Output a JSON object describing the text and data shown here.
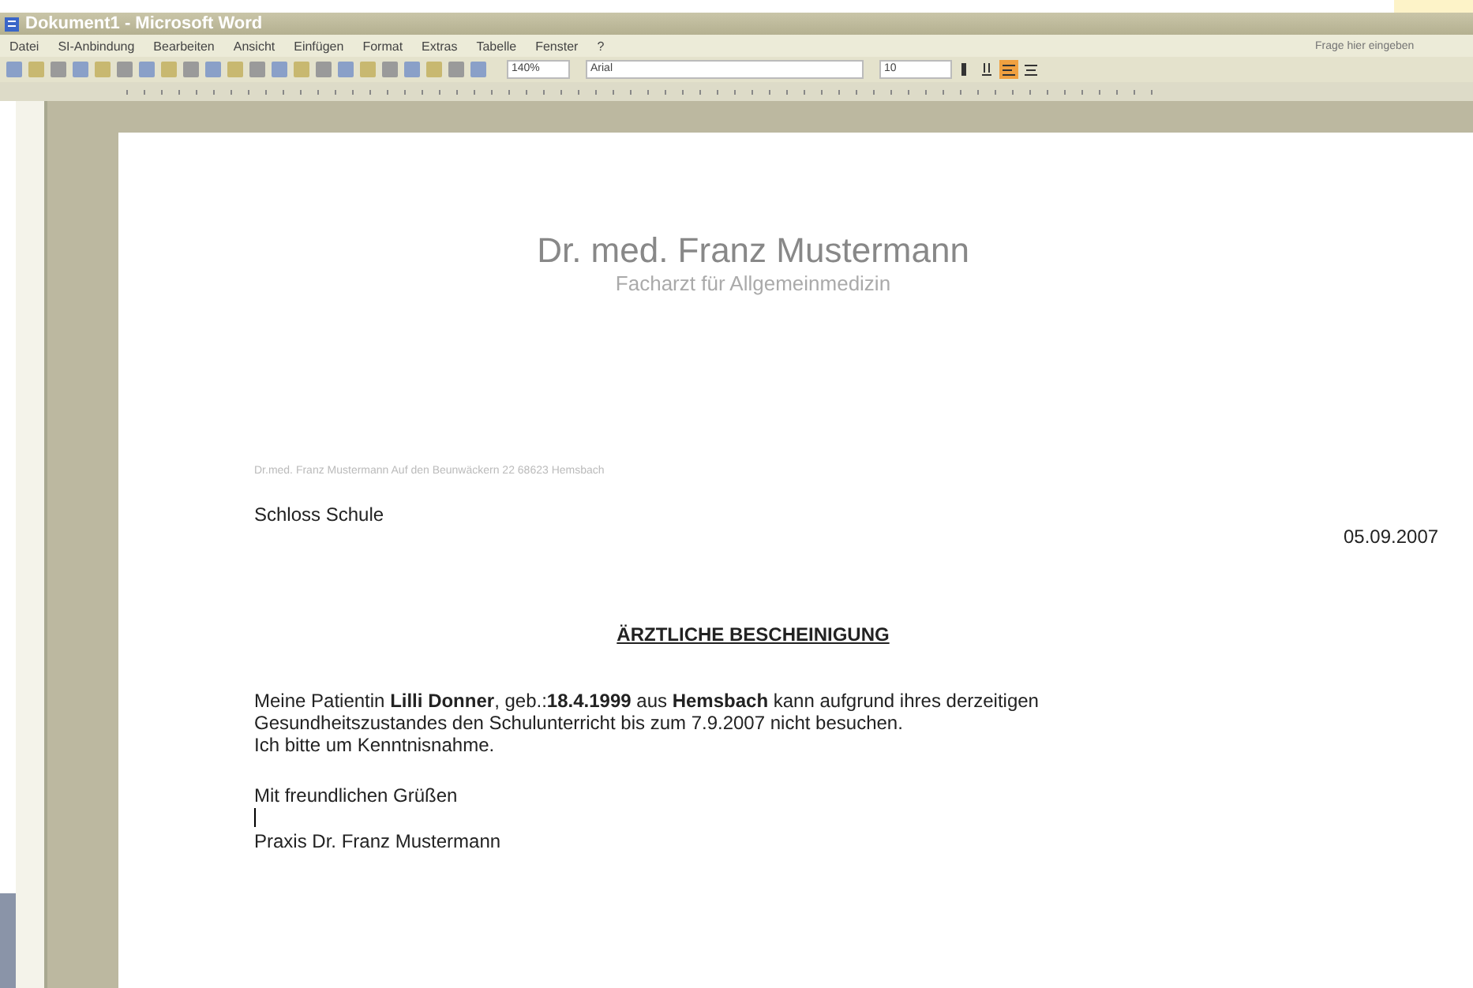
{
  "window": {
    "title": "Dokument1 - Microsoft Word"
  },
  "menu": [
    "Datei",
    "SI-Anbindung",
    "Bearbeiten",
    "Ansicht",
    "Einfügen",
    "Format",
    "Extras",
    "Tabelle",
    "Fenster",
    "?"
  ],
  "help_box": {
    "placeholder": "Frage hier eingeben"
  },
  "toolbar": {
    "zoom": "140%",
    "font": "Arial",
    "size": "10"
  },
  "document": {
    "heading": "Dr. med. Franz Mustermann",
    "subheading": "Facharzt für Allgemeinmedizin",
    "sender_line": "Dr.med. Franz Mustermann Auf den Beunwäckern 22 68623 Hemsbach",
    "recipient": "Schloss Schule",
    "date": "05.09.2007",
    "subject": "ÄRZTLICHE BESCHEINIGUNG",
    "body": "Meine Patientin **Lilli Donner**, geb.:**18.4.1999** aus **Hemsbach** kann aufgrund ihres derzeitigen Gesundheitszustandes den Schulunterricht bis zum 7.9.2007 nicht besuchen.",
    "request": "Ich bitte um Kenntnisnahme.",
    "closing": "Mit freundlichen Grüßen",
    "signature": "Praxis Dr. Franz Mustermann"
  }
}
